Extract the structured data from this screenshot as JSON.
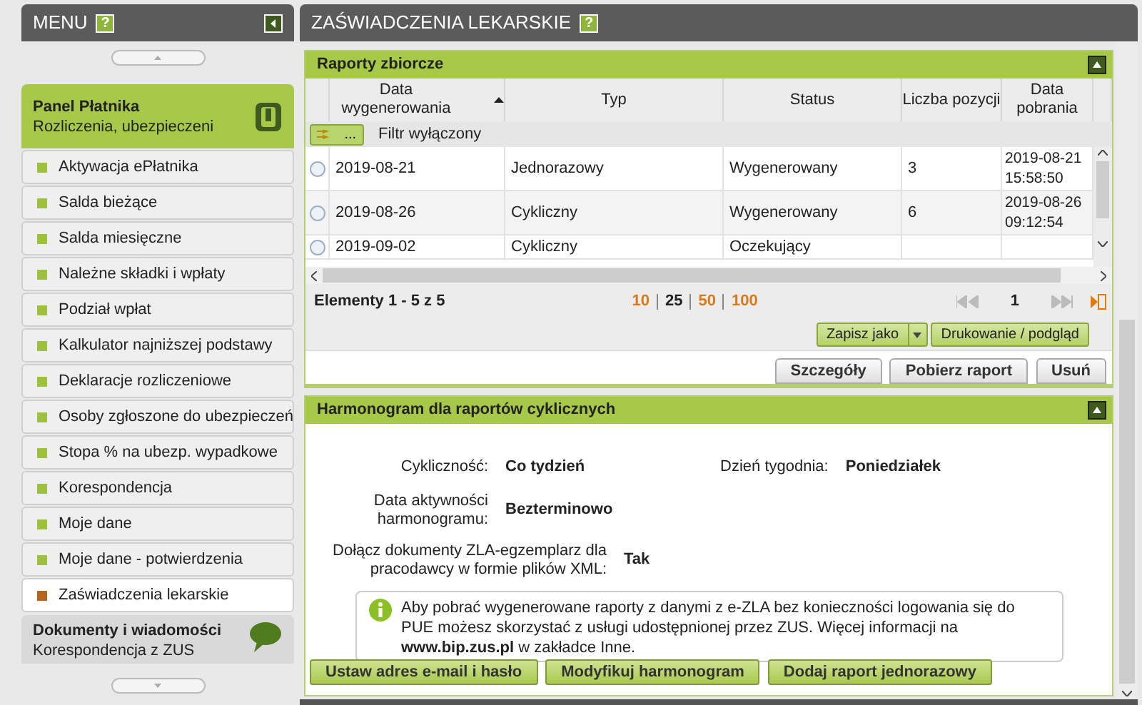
{
  "sidebar": {
    "title": "MENU",
    "help": "?",
    "sections": [
      {
        "kind": "payer",
        "title": "Panel Płatnika",
        "subtitle": "Rozliczenia, ubezpieczeni",
        "expanded": true,
        "items": [
          {
            "label": "Aktywacja ePłatnika",
            "selected": false
          },
          {
            "label": "Salda bieżące",
            "selected": false
          },
          {
            "label": "Salda miesięczne",
            "selected": false
          },
          {
            "label": "Należne składki i wpłaty",
            "selected": false
          },
          {
            "label": "Podział wpłat",
            "selected": false
          },
          {
            "label": "Kalkulator najniższej podstawy",
            "selected": false
          },
          {
            "label": "Deklaracje rozliczeniowe",
            "selected": false
          },
          {
            "label": "Osoby zgłoszone do ubezpieczeń",
            "selected": false
          },
          {
            "label": "Stopa % na ubezp. wypadkowe",
            "selected": false
          },
          {
            "label": "Korespondencja",
            "selected": false
          },
          {
            "label": "Moje dane",
            "selected": false
          },
          {
            "label": "Moje dane - potwierdzenia",
            "selected": false
          },
          {
            "label": "Zaświadczenia lekarskie",
            "selected": true
          }
        ]
      },
      {
        "kind": "documents",
        "title": "Dokumenty i wiadomości",
        "subtitle": "Korespondencja z ZUS",
        "expanded": false
      }
    ]
  },
  "page": {
    "title": "ZAŚWIADCZENIA LEKARSKIE",
    "help": "?"
  },
  "reports_panel": {
    "title": "Raporty zbiorcze",
    "expanded": true,
    "table": {
      "columns": [
        {
          "label": "Data wygenerowania",
          "sorted": true
        },
        {
          "label": "Typ",
          "sorted": false
        },
        {
          "label": "Status",
          "sorted": false
        },
        {
          "label": "Liczba pozycji",
          "sorted": false
        },
        {
          "label": "Data pobrania",
          "sorted": false
        }
      ],
      "filter_button": "...",
      "filter_status": "Filtr wyłączony",
      "rows": [
        {
          "selected": false,
          "cells": [
            "2019-08-21",
            "Jednorazowy",
            "Wygenerowany",
            "3",
            "2019-08-21 15:58:50"
          ]
        },
        {
          "selected": false,
          "cells": [
            "2019-08-26",
            "Cykliczny",
            "Wygenerowany",
            "6",
            "2019-08-26 09:12:54"
          ]
        },
        {
          "selected": false,
          "cells": [
            "2019-09-02",
            "Cykliczny",
            "Oczekujący",
            "",
            ""
          ]
        }
      ]
    },
    "pager": {
      "summary": "Elementy 1 - 5 z 5",
      "page_sizes": [
        {
          "label": "10",
          "selected": false
        },
        {
          "label": "25",
          "selected": true
        },
        {
          "label": "50",
          "selected": false
        },
        {
          "label": "100",
          "selected": false
        }
      ],
      "page": "1"
    },
    "export_buttons": [
      {
        "label": "Zapisz jako",
        "kind": "dropdown"
      },
      {
        "label": "Drukowanie / podgląd",
        "kind": "plain"
      }
    ],
    "actions": [
      "Szczegóły",
      "Pobierz raport",
      "Usuń"
    ]
  },
  "schedule_panel": {
    "title": "Harmonogram dla raportów cyklicznych",
    "expanded": true,
    "fields": [
      {
        "label": "Cykliczność:",
        "value": "Co tydzień"
      },
      {
        "label": "Data aktywności harmonogramu:",
        "value": "Bezterminowo"
      },
      {
        "label": "Dołącz dokumenty ZLA-egzemplarz dla pracodawcy w formie plików XML:",
        "value": "Tak"
      }
    ],
    "day": {
      "label": "Dzień tygodnia:",
      "value": "Poniedziałek"
    },
    "info": {
      "text": "Aby pobrać wygenerowane raporty z danymi z e-ZLA bez konieczności logowania się do PUE możesz skorzystać z usługi udostępnionej przez ZUS. Więcej informacji na",
      "link": "www.bip.zus.pl",
      "text_after": "w zakładce Inne."
    },
    "buttons": [
      "Ustaw adres e-mail i hasło",
      "Modyfikuj harmonogram",
      "Dodaj raport jednorazowy"
    ]
  }
}
